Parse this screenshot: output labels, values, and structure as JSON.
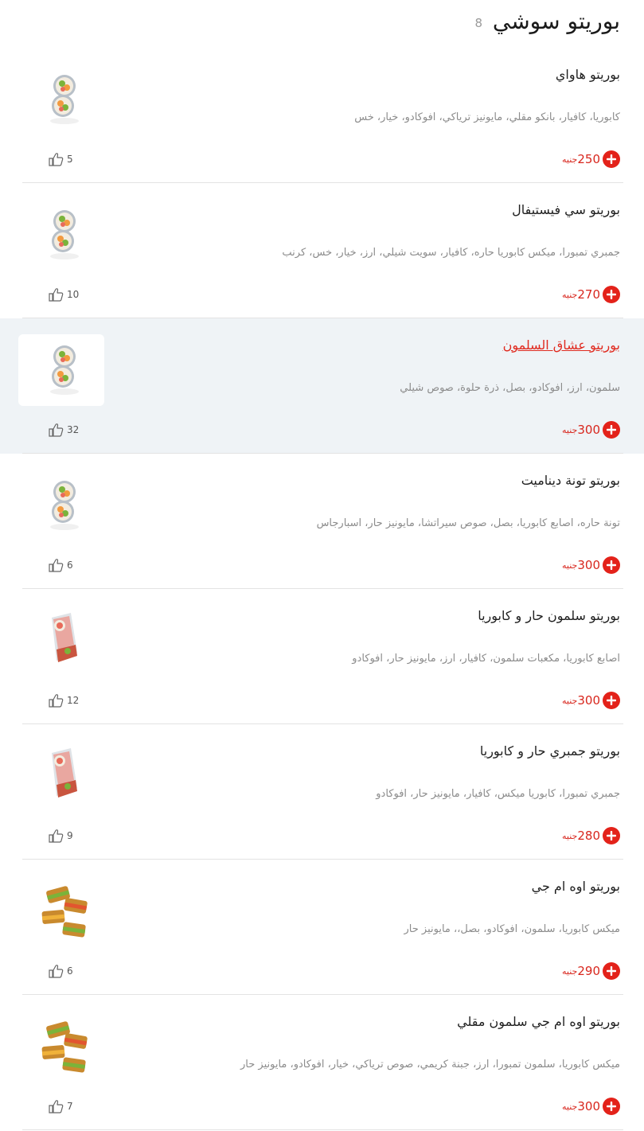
{
  "category": {
    "title": "بوريتو سوشي",
    "count": "8"
  },
  "currency": "جنيه",
  "items": [
    {
      "name": "بوريتو هاواي",
      "description": "كابوريا، كافيار، بانكو مقلي، مايونيز ترياكي، افوكادو، خيار، خس",
      "price": "250",
      "likes": "5",
      "image": "sushi-roll-image"
    },
    {
      "name": "بوريتو سي فيستيفال",
      "description": "جمبري تمبورا، ميكس كابوريا حاره، كافيار، سويت شيلي، ارز، خيار، خس، كرنب",
      "price": "270",
      "likes": "10",
      "image": "sushi-roll-image"
    },
    {
      "name": "بوريتو عشاق السلمون",
      "description": "سلمون، ارز، افوكادو، بصل، ذرة حلوة، صوص شيلي",
      "price": "300",
      "likes": "32",
      "image": "sushi-roll-image"
    },
    {
      "name": "بوريتو تونة ديناميت",
      "description": "تونة حاره، اصابع كابوريا، بصل، صوص سيراتشا، مايونيز حار، اسبارجاس",
      "price": "300",
      "likes": "6",
      "image": "sushi-roll-image"
    },
    {
      "name": "بوريتو سلمون حار و كابوريا",
      "description": "اصابع كابوريا، مكعبات سلمون، كافيار، ارز، مايونيز حار، افوكادو",
      "price": "300",
      "likes": "12",
      "image": "sushi-wrap-image"
    },
    {
      "name": "بوريتو جمبري حار و كابوريا",
      "description": "جمبري تمبورا، كابوريا ميكس، كافيار، مايونيز حار، افوكادو",
      "price": "280",
      "likes": "9",
      "image": "sushi-wrap-image"
    },
    {
      "name": "بوريتو اوه ام جي",
      "description": "ميكس كابوريا، سلمون، افوكادو، بصل،، مايونيز حار",
      "price": "290",
      "likes": "6",
      "image": "fried-burrito-image"
    },
    {
      "name": "بوريتو اوه ام جي سلمون مقلي",
      "description": "ميكس كابوريا، سلمون تمبورا، ارز، جبنة كريمي، صوص ترياكي، خيار، افوكادو، مايونيز حار",
      "price": "300",
      "likes": "7",
      "image": "fried-burrito-image"
    }
  ],
  "colors": {
    "accent": "#e3221a",
    "price": "#d8261d",
    "active_row": "#eff3f6",
    "divider": "#e3e3e3"
  }
}
